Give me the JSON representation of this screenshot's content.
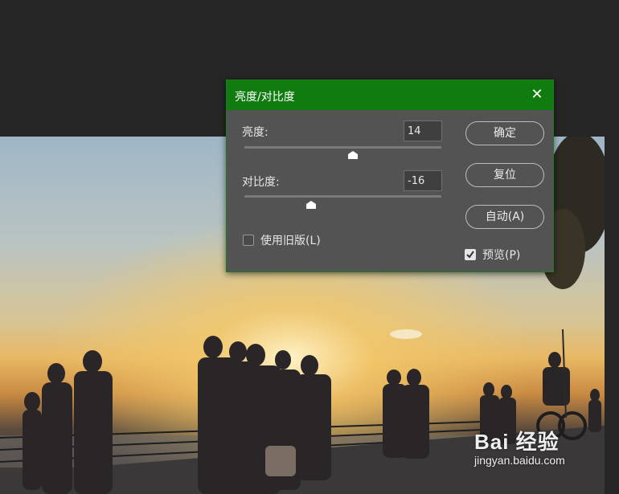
{
  "dialog": {
    "title": "亮度/对比度",
    "close_icon": "close-icon",
    "brightness": {
      "label": "亮度:",
      "value": "14",
      "slider_fraction": 0.55
    },
    "contrast": {
      "label": "对比度:",
      "value": "-16",
      "slider_fraction": 0.34
    },
    "legacy": {
      "label": "使用旧版(L)",
      "checked": false
    },
    "preview": {
      "label": "预览(P)",
      "checked": true
    },
    "buttons": {
      "ok": "确定",
      "reset": "复位",
      "auto": "自动(A)"
    },
    "accent_color": "#107c10"
  },
  "canvas": {
    "image_description_icon": "sunset-promenade-photo"
  },
  "watermark": {
    "brand": "Bai 经验",
    "site": "jingyan.baidu.com"
  }
}
